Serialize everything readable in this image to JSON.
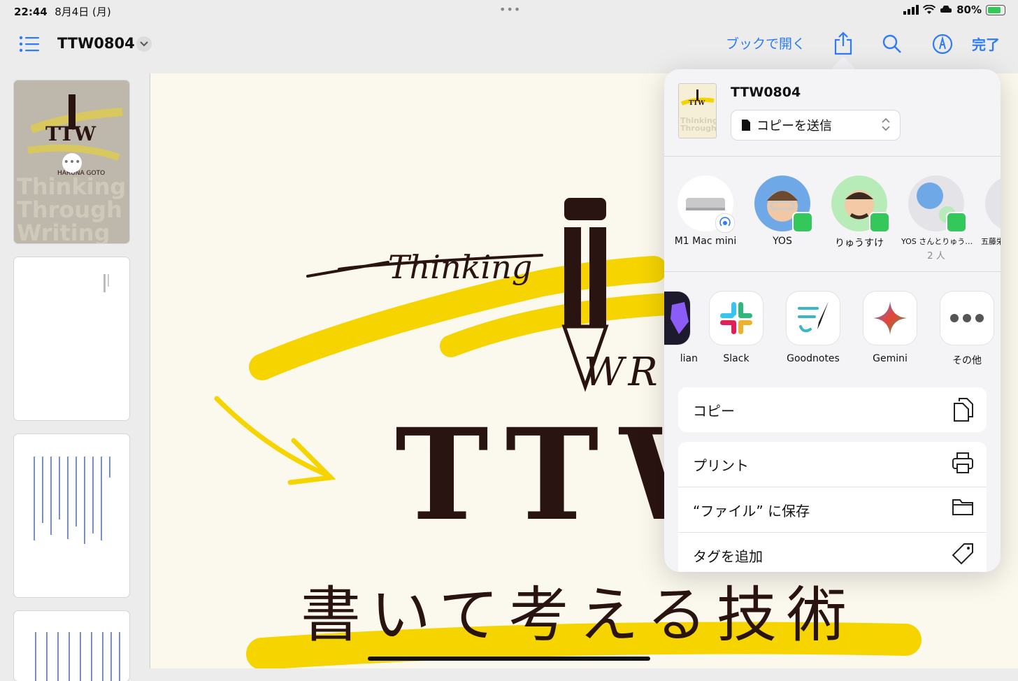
{
  "status": {
    "time": "22:44",
    "date": "8月4日 (月)",
    "battery": "80%",
    "battery_level": 0.8
  },
  "toolbar": {
    "doc_title": "TTW0804",
    "open_in_books": "ブックで開く",
    "done": "完了"
  },
  "document": {
    "script_top": "Thinking",
    "script_right": "WR",
    "big_title": "TTW",
    "subtitle": "書いて考える技術"
  },
  "sidebar": {
    "thumb1": {
      "line1": "Thinking",
      "line2": "Through",
      "line3": "Writing",
      "logo": "TTW",
      "author": "HARUNA GOTO"
    }
  },
  "share": {
    "title": "TTW0804",
    "send_option": "コピーを送信",
    "people": [
      {
        "name": "M1 Mac mini",
        "sub": ""
      },
      {
        "name": "YOS",
        "sub": ""
      },
      {
        "name": "りゅうすけ",
        "sub": ""
      },
      {
        "name": "YOS さんとりゅう…",
        "sub": "2 人"
      },
      {
        "name": "五藤栄",
        "sub": ""
      }
    ],
    "apps": [
      {
        "name": "lian"
      },
      {
        "name": "Slack"
      },
      {
        "name": "Goodnotes"
      },
      {
        "name": "Gemini"
      },
      {
        "name": "その他"
      }
    ],
    "actions": {
      "copy": "コピー",
      "print": "プリント",
      "save_files": "“ファイル” に保存",
      "add_tag": "タグを追加"
    }
  },
  "colors": {
    "accent": "#2e7cf6",
    "highlight": "#f5d400",
    "ink": "#2a1412",
    "green": "#34c759"
  }
}
